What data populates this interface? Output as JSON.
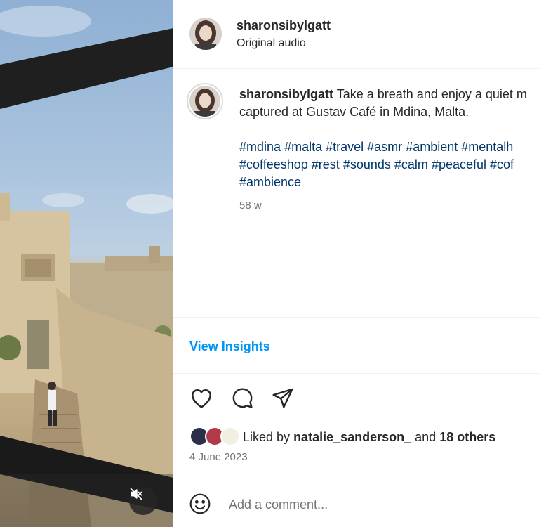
{
  "post": {
    "username": "sharonsibylgatt",
    "audio": "Original audio"
  },
  "caption": {
    "username": "sharonsibylgatt",
    "line1": "Take a breath and enjoy a quiet m",
    "line2": "captured at Gustav Café in Mdina, Malta.",
    "hashtag_lines": [
      [
        "#mdina",
        "#malta",
        "#travel",
        "#asmr",
        "#ambient",
        "#mentalh"
      ],
      [
        "#coffeeshop",
        "#rest",
        "#sounds",
        "#calm",
        "#peaceful",
        "#cof"
      ],
      [
        "#ambience"
      ]
    ],
    "time_ago": "58 w"
  },
  "insights": {
    "label": "View Insights"
  },
  "likes": {
    "prefix": "Liked by",
    "first_liker": "natalie_sanderson_",
    "conjunction": "and",
    "others": "18 others",
    "liker_avatar_colors": [
      "#2a2f4a",
      "#b23a48",
      "#f3eee2"
    ]
  },
  "date": "4 June 2023",
  "comment": {
    "placeholder": "Add a comment..."
  },
  "icons": {
    "like": "heart-icon",
    "comment": "comment-bubble-icon",
    "share": "paper-plane-icon",
    "emoji": "smiley-icon",
    "mute": "speaker-muted-icon"
  },
  "colors": {
    "link": "#0095f6",
    "hashtag": "#00376b",
    "muted_text": "#737373"
  }
}
